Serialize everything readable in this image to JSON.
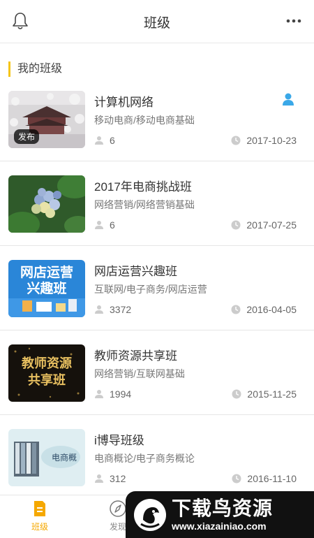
{
  "header": {
    "title": "班级"
  },
  "section_title": "我的班级",
  "classes": [
    {
      "name": "计算机网络",
      "category": "移动电商/移动电商基础",
      "members": "6",
      "date": "2017-10-23",
      "badge": "发布"
    },
    {
      "name": "2017年电商挑战班",
      "category": "网络营销/网络营销基础",
      "members": "6",
      "date": "2017-07-25"
    },
    {
      "name": "网店运营兴趣班",
      "category": "互联网/电子商务/网店运营",
      "members": "3372",
      "date": "2016-04-05",
      "thumb_text": [
        "网店运营",
        "兴趣班"
      ]
    },
    {
      "name": "教师资源共享班",
      "category": "网络营销/互联网基础",
      "members": "1994",
      "date": "2015-11-25",
      "thumb_text": [
        "教师资源",
        "共享班"
      ]
    },
    {
      "name": "i博导班级",
      "category": "电商概论/电子商务概论",
      "members": "312",
      "date": "2016-11-10",
      "thumb_text": [
        "电商概"
      ]
    }
  ],
  "tabbar": {
    "tab_class": "班级",
    "tab_discover": "发现"
  },
  "watermark": {
    "main": "下载鸟资源",
    "url": "www.xiazainiao.com"
  },
  "colors": {
    "accent": "#f5a800",
    "section_bar": "#f5c518",
    "user_icon": "#3aa8e8"
  }
}
